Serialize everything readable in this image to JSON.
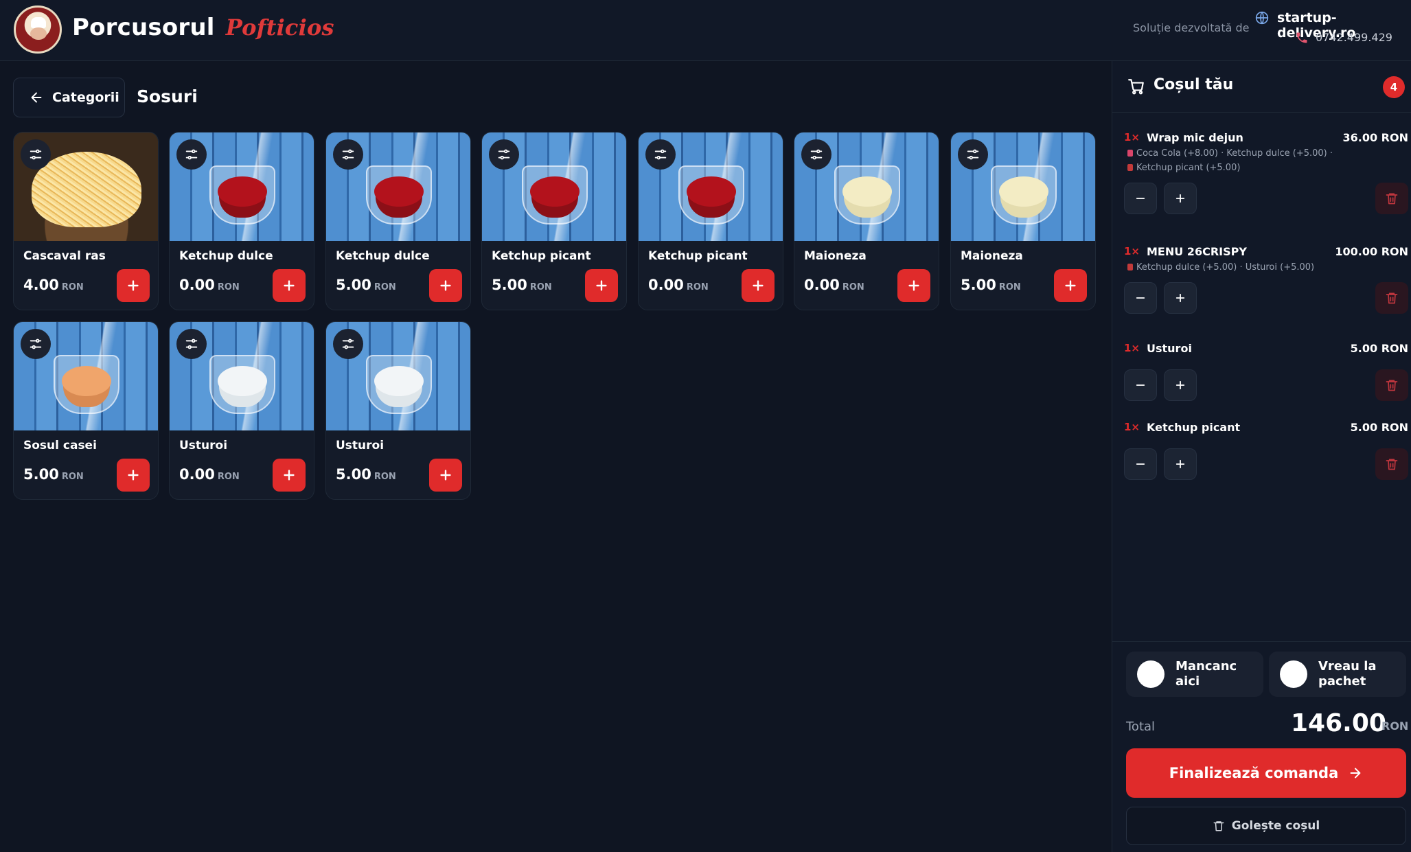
{
  "header": {
    "brand_name": "Porcusorul",
    "brand_script": "Pofticios",
    "solution_text": "Soluție dezvoltată de",
    "site": "startup-delivery.ro",
    "phone": "0742.499.429"
  },
  "toolbar": {
    "back_label": "Categorii",
    "category_title": "Sosuri"
  },
  "products": [
    {
      "name": "Cascaval ras",
      "price": "4.00",
      "currency": "RON",
      "image": "cheese"
    },
    {
      "name": "Ketchup dulce",
      "price": "0.00",
      "currency": "RON",
      "image": "ketchup"
    },
    {
      "name": "Ketchup dulce",
      "price": "5.00",
      "currency": "RON",
      "image": "ketchup"
    },
    {
      "name": "Ketchup picant",
      "price": "5.00",
      "currency": "RON",
      "image": "ketchup"
    },
    {
      "name": "Ketchup picant",
      "price": "0.00",
      "currency": "RON",
      "image": "ketchup"
    },
    {
      "name": "Maioneza",
      "price": "0.00",
      "currency": "RON",
      "image": "mayo"
    },
    {
      "name": "Maioneza",
      "price": "5.00",
      "currency": "RON",
      "image": "mayo"
    },
    {
      "name": "Sosul casei",
      "price": "5.00",
      "currency": "RON",
      "image": "house"
    },
    {
      "name": "Usturoi",
      "price": "0.00",
      "currency": "RON",
      "image": "garlic"
    },
    {
      "name": "Usturoi",
      "price": "5.00",
      "currency": "RON",
      "image": "garlic"
    }
  ],
  "cart": {
    "title": "Coșul tău",
    "count": "4",
    "items": [
      {
        "qty": "1×",
        "name": "Wrap mic dejun",
        "price": "36.00 RON",
        "options_line1": "Coca Cola (+8.00)  ·  Ketchup dulce (+5.00)  ·",
        "options_line2": "Ketchup picant (+5.00)"
      },
      {
        "qty": "1×",
        "name": "MENU 26CRISPY",
        "price": "100.00 RON",
        "options_line1": "Ketchup dulce (+5.00)  ·  Usturoi (+5.00)",
        "options_line2": ""
      },
      {
        "qty": "1×",
        "name": "Usturoi",
        "price": "5.00 RON",
        "options_line1": "",
        "options_line2": ""
      },
      {
        "qty": "1×",
        "name": "Ketchup picant",
        "price": "5.00 RON",
        "options_line1": "",
        "options_line2": ""
      }
    ],
    "dine_in": "Mancanc aici",
    "takeaway_line1": "Vreau la",
    "takeaway_line2": "pachet",
    "total_label": "Total",
    "total_value": "146.00",
    "total_currency": "RON",
    "checkout_label": "Finalizează comanda",
    "clear_label": "Golește coșul"
  },
  "colors": {
    "accent": "#e02b2b",
    "background": "#0f1522",
    "panel": "#111827"
  }
}
